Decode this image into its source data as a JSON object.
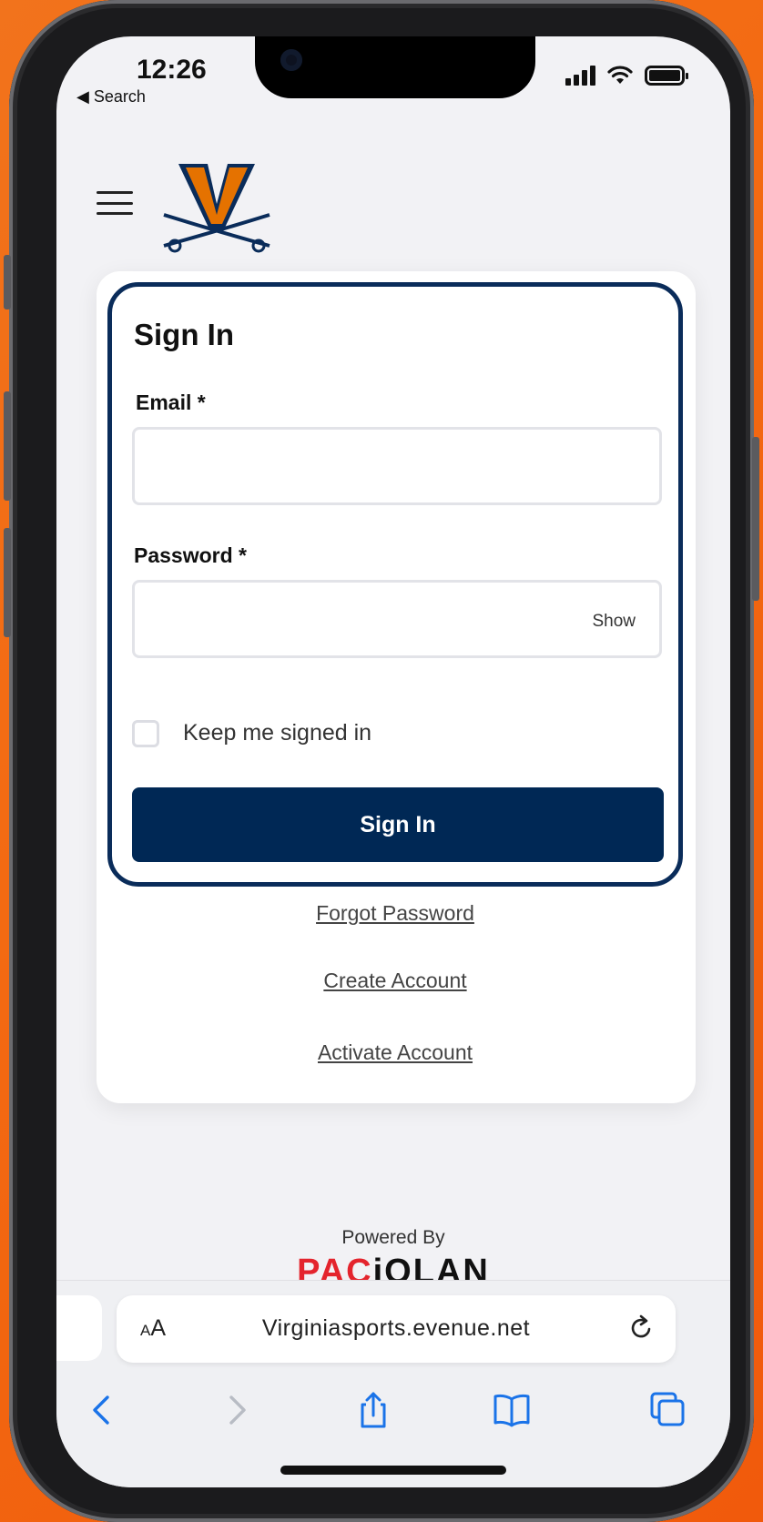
{
  "status_bar": {
    "time": "12:26",
    "back_label": "◀ Search"
  },
  "colors": {
    "background_orange": "#f36a12",
    "brand_navy": "#002855",
    "brand_orange": "#e57200",
    "pac_red": "#e4242d"
  },
  "header": {
    "menu_icon": "hamburger-icon",
    "logo_icon": "cavaliers-v-sabres-logo"
  },
  "sign_in_form": {
    "title": "Sign In",
    "email_label": "Email *",
    "email_value": "",
    "password_label": "Password *",
    "password_value": "",
    "show_label": "Show",
    "keep_signed_in_label": "Keep me signed in",
    "keep_signed_in_checked": false,
    "submit_label": "Sign In"
  },
  "links": {
    "forgot_password": "Forgot Password",
    "create_account": "Create Account",
    "activate_account": "Activate Account"
  },
  "footer": {
    "powered_by": "Powered By",
    "brand_red": "PAC",
    "brand_dark": "iOLAN"
  },
  "browser": {
    "aa_label": "AA",
    "url": "Virginiasports.evenue.net",
    "icons": [
      "back-icon",
      "forward-icon",
      "share-icon",
      "bookmarks-icon",
      "tabs-icon"
    ]
  }
}
